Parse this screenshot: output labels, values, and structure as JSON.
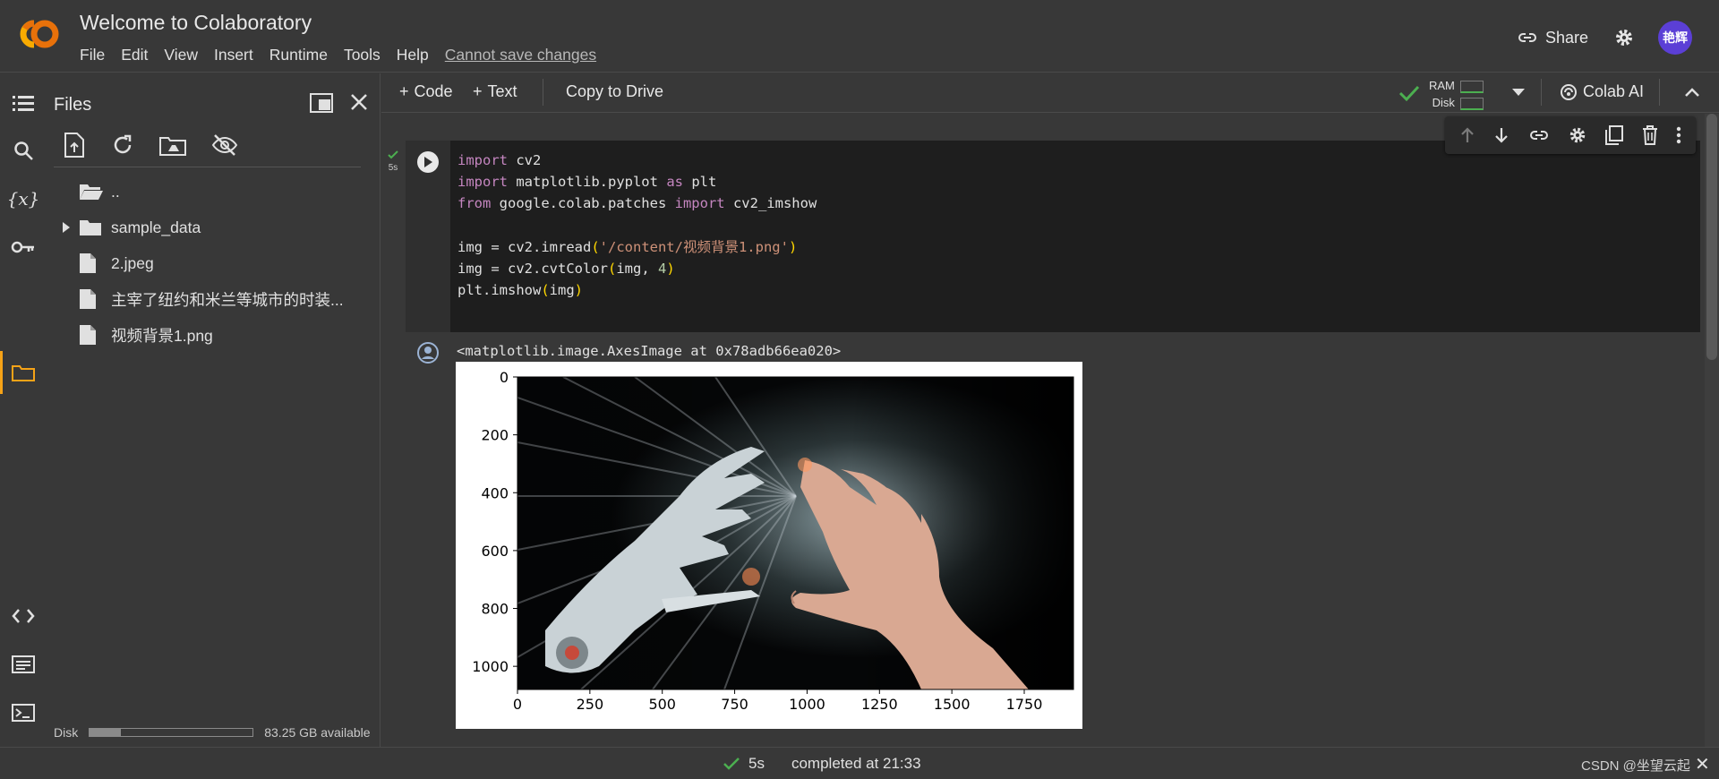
{
  "header": {
    "title": "Welcome to Colaboratory",
    "menu": [
      "File",
      "Edit",
      "View",
      "Insert",
      "Runtime",
      "Tools",
      "Help"
    ],
    "save_warning": "Cannot save changes",
    "share_label": "Share",
    "avatar_text": "艳辉",
    "avatar_color": "#5b3fd6"
  },
  "files_panel": {
    "title": "Files",
    "items": [
      {
        "name": "..",
        "kind": "folder-open"
      },
      {
        "name": "sample_data",
        "kind": "folder"
      },
      {
        "name": "2.jpeg",
        "kind": "file"
      },
      {
        "name": "主宰了纽约和米兰等城市的时装...",
        "kind": "file"
      },
      {
        "name": "视频背景1.png",
        "kind": "file"
      }
    ],
    "disk_label": "Disk",
    "disk_available": "83.25 GB available",
    "disk_used_fraction": 0.19
  },
  "toolbar": {
    "code_label": "Code",
    "text_label": "Text",
    "copy_label": "Copy to Drive",
    "ram_label": "RAM",
    "disk_label": "Disk",
    "colab_ai_label": "Colab AI"
  },
  "cell": {
    "exec_time": "5s",
    "code_lines": [
      "import cv2",
      "import matplotlib.pyplot as plt",
      "from google.colab.patches import cv2_imshow",
      "",
      "img = cv2.imread('/content/视频背景1.png')",
      "img = cv2.cvtColor(img, 4)",
      "plt.imshow(img)"
    ],
    "output_text": "<matplotlib.image.AxesImage at 0x78adb66ea020>"
  },
  "plot": {
    "x_ticks": [
      "0",
      "250",
      "500",
      "750",
      "1000",
      "1250",
      "1500",
      "1750"
    ],
    "y_ticks": [
      "0",
      "200",
      "400",
      "600",
      "800",
      "1000"
    ]
  },
  "chart_data": {
    "type": "image",
    "xlim": [
      0,
      1920
    ],
    "ylim": [
      1080,
      0
    ],
    "x_ticks": [
      0,
      250,
      500,
      750,
      1000,
      1250,
      1500,
      1750
    ],
    "y_ticks": [
      0,
      200,
      400,
      600,
      800,
      1000
    ]
  },
  "statusbar": {
    "time": "5s",
    "completed": "completed at 21:33",
    "watermark": "CSDN @坐望云起"
  },
  "colors": {
    "accent": "#f6a317",
    "success": "#4caf50",
    "background": "#383838",
    "code_bg": "#1e1e1e"
  }
}
